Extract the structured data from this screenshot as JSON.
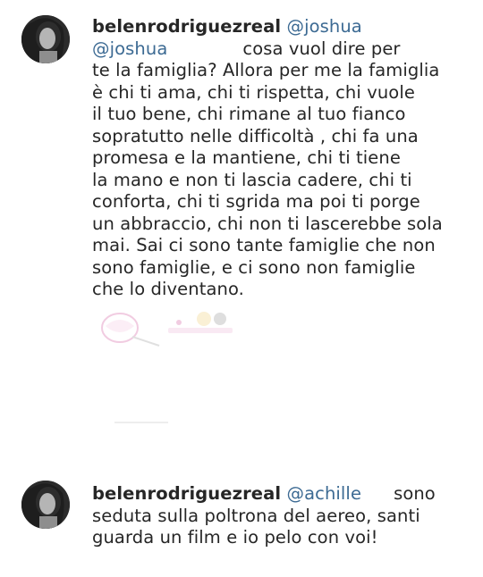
{
  "comments": [
    {
      "username": "belenrodriguezreal",
      "mention_top": "@joshua",
      "mention_reply": "@joshua",
      "lines": [
        "cosa vuol dire per",
        "te la famiglia? Allora per me la famiglia",
        "è chi ti ama, chi ti rispetta, chi vuole",
        "il tuo bene, chi rimane al tuo fianco",
        "sopratutto nelle difficoltà , chi fa una",
        "promesa e la mantiene, chi ti tiene",
        "la mano e non ti lascia cadere, chi ti",
        "conforta, chi ti sgrida ma poi ti porge",
        "un abbraccio, chi non ti lascerebbe sola",
        "mai. Sai ci sono tante famiglie che non",
        "sono famiglie, e ci sono non famiglie",
        "che lo diventano."
      ]
    },
    {
      "username": "belenrodriguezreal",
      "mention": "@achille",
      "lines": [
        "sono",
        "seduta sulla poltrona del aereo, santi",
        "guarda un film e io pelo con voi!"
      ]
    }
  ],
  "colors": {
    "mention": "#3c6a93",
    "text": "#262626"
  },
  "icons": {
    "avatar": "profile-photo-avatar",
    "watermark": "watermark-logo"
  }
}
